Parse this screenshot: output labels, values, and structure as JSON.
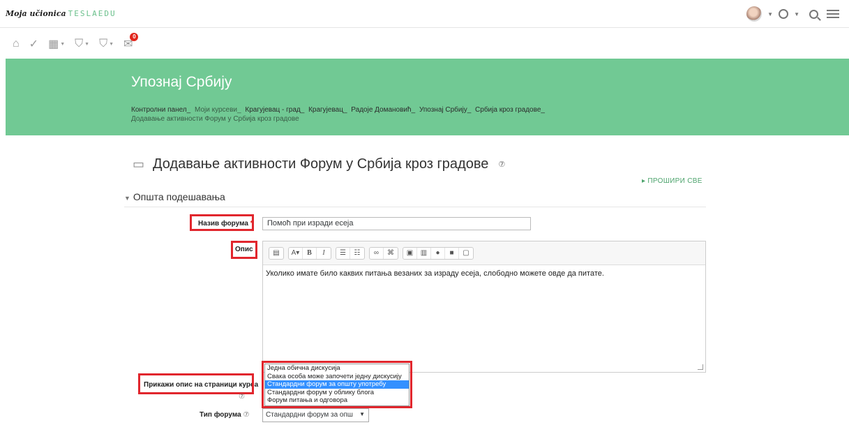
{
  "brand": {
    "name": "Moja učionica",
    "product": "TESLAEDU"
  },
  "nav": {
    "mail_badge": "0"
  },
  "banner": {
    "title": "Упознај Србију",
    "breadcrumbs": [
      "Контролни панел_",
      "Моји курсеви_",
      "Крагујевац - град_",
      "Крагујевац_",
      "Радоје Домановић_",
      "Упознај Србију_",
      "Србија кроз градове_",
      "Додавање активности Форум у Србија кроз градове"
    ]
  },
  "page": {
    "title": "Додавање активности Форум у Србија кроз градове",
    "expand_all": "▸ ПРОШИРИ СВЕ",
    "section": "Општа подешавања"
  },
  "form": {
    "name_label": "Назив форума",
    "name_required": "*",
    "name_value": "Помоћ при изради есеја",
    "description_label": "Опис",
    "description_text": "Уколико имате било каквих питања везаних за израду есеја, слободно можете овде да питате.",
    "show_description_label": "Прикажи опис на страници курса",
    "forum_type_label": "Тип форума",
    "forum_type_value": "Стандардни форум за опш",
    "forum_type_options": [
      "Једна обична дискусија",
      "Свака особа може започети једну дискусију",
      "Стандардни форум за општу употребу",
      "Стандардни форум у облику блога",
      "Форум питања и одговора"
    ],
    "selected_option_index": 2
  },
  "colors": {
    "banner": "#71c994",
    "highlight": "#e1262d",
    "selection": "#3390ff"
  }
}
